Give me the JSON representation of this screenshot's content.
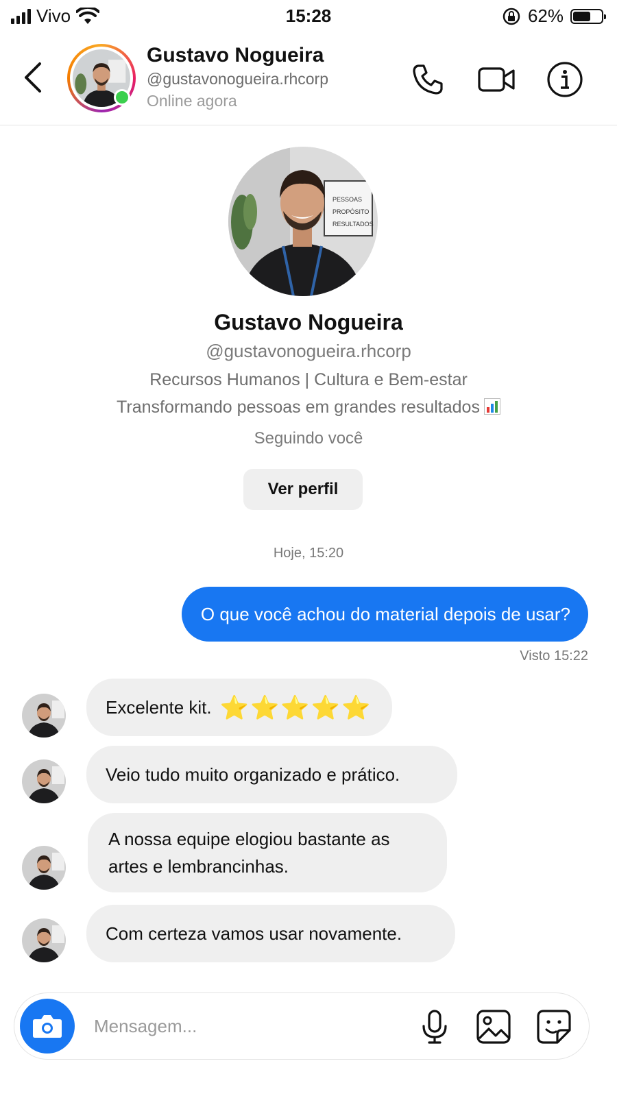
{
  "status_bar": {
    "carrier": "Vivo",
    "time": "15:28",
    "battery_percent": "62%",
    "battery_level": 0.62
  },
  "header": {
    "name": "Gustavo Nogueira",
    "handle": "@gustavonogueira.rhcorp",
    "status": "Online agora",
    "icons": [
      "back-chevron-icon",
      "phone-icon",
      "video-camera-icon",
      "info-icon"
    ]
  },
  "profile": {
    "name": "Gustavo Nogueira",
    "handle": "@gustavonogueira.rhcorp",
    "bio_line1": "Recursos Humanos | Cultura e Bem-estar",
    "bio_line2": "Transformando pessoas em grandes resultados",
    "follow_status": "Seguindo você",
    "view_profile_label": "Ver perfil",
    "poster_lines": [
      "PESSOAS",
      "PROPÓSITO",
      "RESULTADOS"
    ]
  },
  "chat": {
    "day_label": "Hoje, 15:20",
    "outgoing": [
      {
        "text": "O que você achou do material depois de usar?",
        "seen": "Visto 15:22"
      }
    ],
    "incoming": [
      {
        "text": "Excelente kit.",
        "stars": "⭐⭐⭐⭐⭐",
        "rating": 5
      },
      {
        "text": "Veio tudo muito organizado e prático."
      },
      {
        "line1": "A nossa equipe elogiou bastante as",
        "line2": "artes e lembrancinhas."
      },
      {
        "text": "Com certeza vamos usar novamente."
      }
    ]
  },
  "composer": {
    "placeholder": "Mensagem...",
    "icons": [
      "camera-icon",
      "microphone-icon",
      "gallery-icon",
      "sticker-icon"
    ]
  },
  "colors": {
    "accent_blue": "#1877f2",
    "online_green": "#3ccf4e",
    "incoming_bubble": "#efefef"
  }
}
